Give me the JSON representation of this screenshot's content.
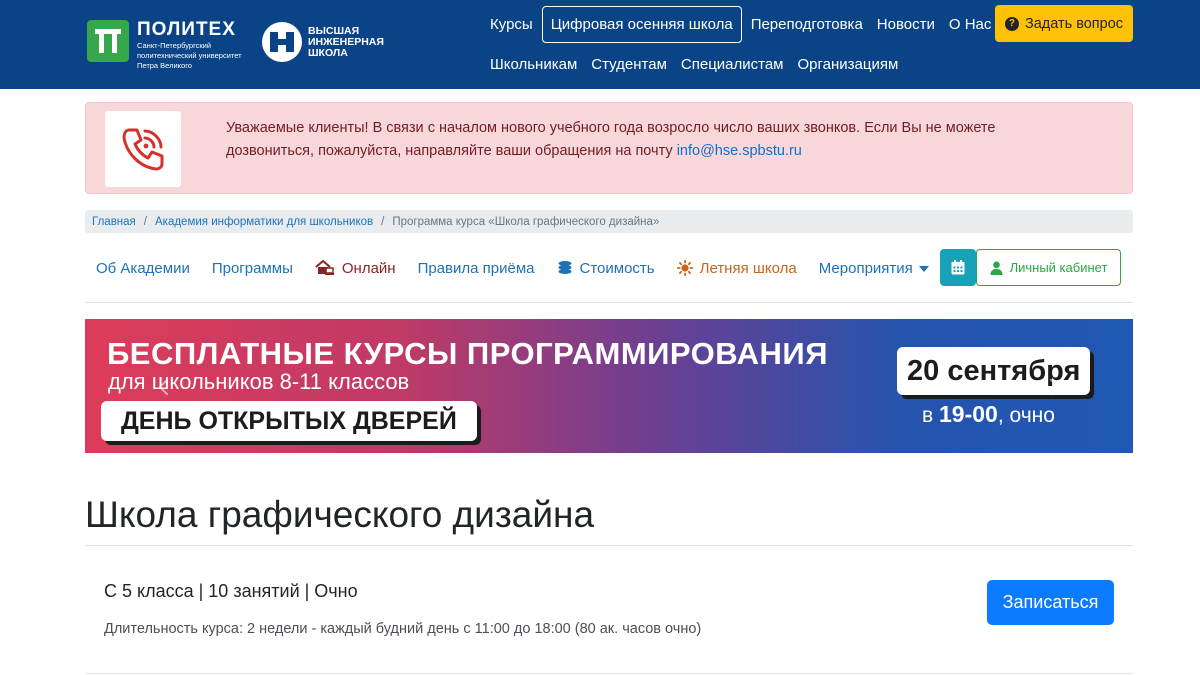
{
  "header": {
    "politech": {
      "title": "ПОЛИТЕХ",
      "subtitle_line1": "Санкт-Петербургский",
      "subtitle_line2": "политехнический университет",
      "subtitle_line3": "Петра Великого"
    },
    "hse": {
      "line1": "ВЫСШАЯ",
      "line2": "ИНЖЕНЕРНАЯ",
      "line3": "ШКОЛА"
    },
    "nav_primary": [
      {
        "label": "Курсы"
      },
      {
        "label": "Цифровая осенняя школа"
      },
      {
        "label": "Переподготовка"
      },
      {
        "label": "Новости"
      },
      {
        "label": "О Нас"
      }
    ],
    "nav_secondary": [
      {
        "label": "Школьникам"
      },
      {
        "label": "Студентам"
      },
      {
        "label": "Специалистам"
      },
      {
        "label": "Организациям"
      }
    ],
    "ask_button": "Задать вопрос",
    "ask_icon": "question-circle-icon"
  },
  "alert": {
    "text": "Уважаемые клиенты! В связи с началом нового учебного года возросло число ваших звонков. Если Вы не можете дозвониться, пожалуйста, направляйте ваши обращения на почту ",
    "email": "info@hse.spbstu.ru",
    "icon": "phone-ringing-icon"
  },
  "breadcrumb": {
    "home": "Главная",
    "section": "Академия информатики для школьников",
    "current": "Программа курса «Школа графического дизайна»"
  },
  "subnav": {
    "items": [
      {
        "label": "Об Академии"
      },
      {
        "label": "Программы"
      },
      {
        "label": "Онлайн",
        "icon": "house-laptop-icon"
      },
      {
        "label": "Правила приёма"
      },
      {
        "label": "Стоимость",
        "icon": "coins-icon"
      },
      {
        "label": "Летняя школа",
        "icon": "sun-icon"
      },
      {
        "label": "Мероприятия"
      }
    ],
    "calendar_icon": "calendar-icon",
    "cabinet_label": "Личный кабинет",
    "cabinet_icon": "user-icon"
  },
  "banner": {
    "headline": "БЕСПЛАТНЫЕ КУРСЫ ПРОГРАММИРОВАНИЯ",
    "subheadline": "для школьников 8-11 классов",
    "pill": "ДЕНЬ ОТКРЫТЫХ ДВЕРЕЙ",
    "date": "20 сентября",
    "time_prefix": "в ",
    "time": "19-00",
    "time_suffix": ", очно"
  },
  "page": {
    "title": "Школа графического дизайна",
    "course_meta": "С 5 класса | 10 занятий | Очно",
    "duration": "Длительность курса: 2 недели - каждый будний день с 11:00 до 18:00 (80 ак. часов очно)",
    "enroll_button": "Записаться"
  },
  "colors": {
    "header_bg": "#0a4486",
    "accent_yellow": "#ffc107",
    "alert_bg": "#f8d7da",
    "link_blue": "#1d72b8",
    "primary_button": "#0d7bff",
    "success_green": "#28a745",
    "info_teal": "#17a2b8"
  }
}
